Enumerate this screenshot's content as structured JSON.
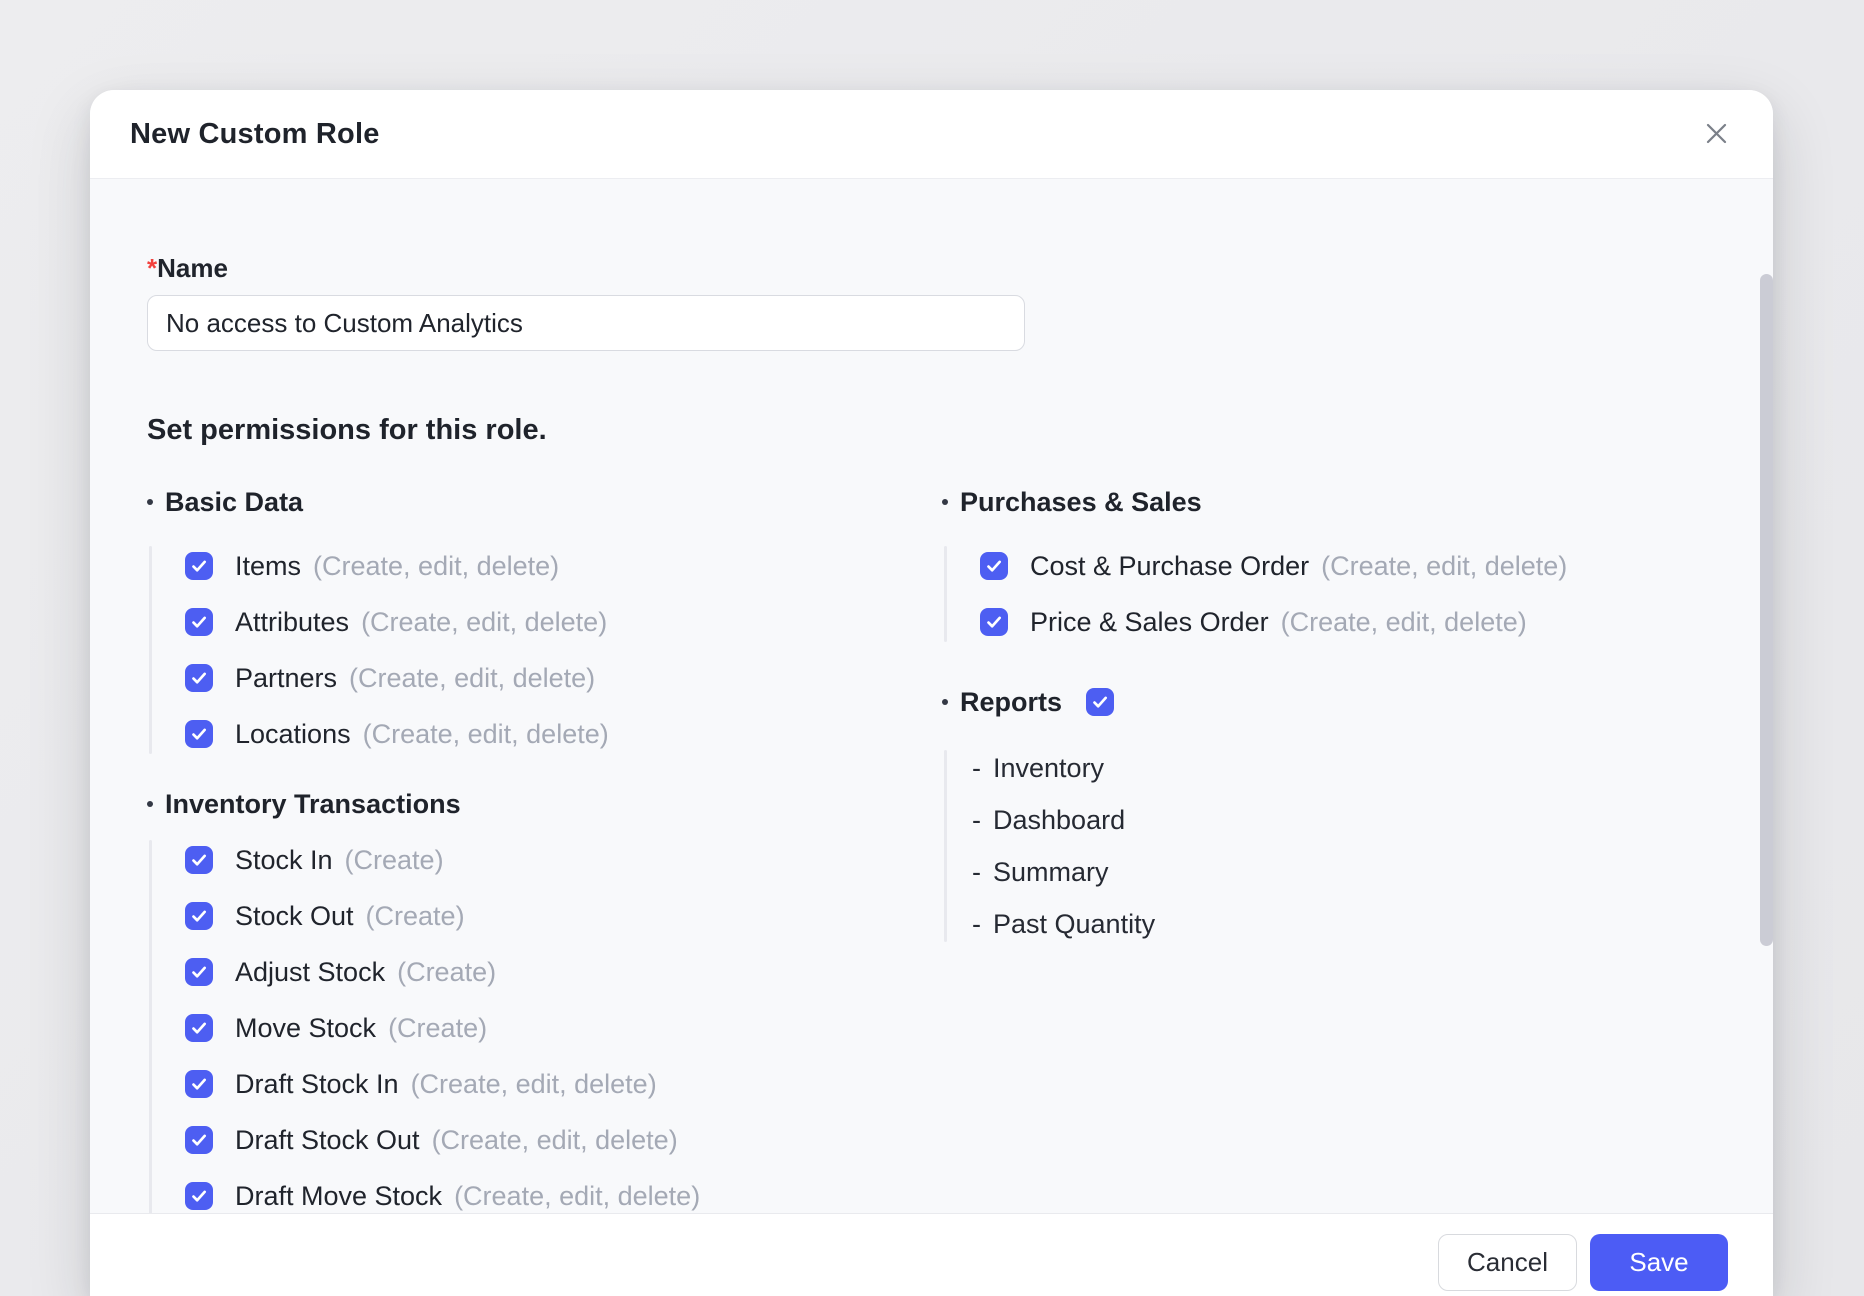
{
  "modal": {
    "title": "New Custom Role",
    "name_field": {
      "required_mark": "*",
      "label": "Name",
      "value": "No access to Custom Analytics"
    },
    "permissions_heading": "Set permissions for this role.",
    "accent_color": "#4d5ef2",
    "muted_text_color": "#a4a9b5",
    "columns": {
      "left": [
        {
          "header": "Basic Data",
          "items": [
            {
              "label": "Items",
              "detail": "(Create, edit, delete)",
              "checked": true
            },
            {
              "label": "Attributes",
              "detail": "(Create, edit, delete)",
              "checked": true
            },
            {
              "label": "Partners",
              "detail": "(Create, edit, delete)",
              "checked": true
            },
            {
              "label": "Locations",
              "detail": "(Create, edit, delete)",
              "checked": true
            }
          ]
        },
        {
          "header": "Inventory Transactions",
          "items": [
            {
              "label": "Stock In",
              "detail": "(Create)",
              "checked": true
            },
            {
              "label": "Stock Out",
              "detail": "(Create)",
              "checked": true
            },
            {
              "label": "Adjust Stock",
              "detail": "(Create)",
              "checked": true
            },
            {
              "label": "Move Stock",
              "detail": "(Create)",
              "checked": true
            },
            {
              "label": "Draft Stock In",
              "detail": "(Create, edit, delete)",
              "checked": true
            },
            {
              "label": "Draft Stock Out",
              "detail": "(Create, edit, delete)",
              "checked": true
            },
            {
              "label": "Draft Move Stock",
              "detail": "(Create, edit, delete)",
              "checked": true
            }
          ]
        }
      ],
      "right": [
        {
          "header": "Purchases & Sales",
          "items": [
            {
              "label": "Cost & Purchase Order",
              "detail": "(Create, edit, delete)",
              "checked": true
            },
            {
              "label": "Price & Sales Order",
              "detail": "(Create, edit, delete)",
              "checked": true
            }
          ]
        },
        {
          "header": "Reports",
          "header_checked": true,
          "list": [
            {
              "prefix": "-",
              "label": "Inventory"
            },
            {
              "prefix": "-",
              "label": "Dashboard"
            },
            {
              "prefix": "-",
              "label": "Summary"
            },
            {
              "prefix": "-",
              "label": "Past Quantity"
            }
          ]
        }
      ]
    },
    "footer": {
      "cancel_label": "Cancel",
      "save_label": "Save"
    }
  }
}
